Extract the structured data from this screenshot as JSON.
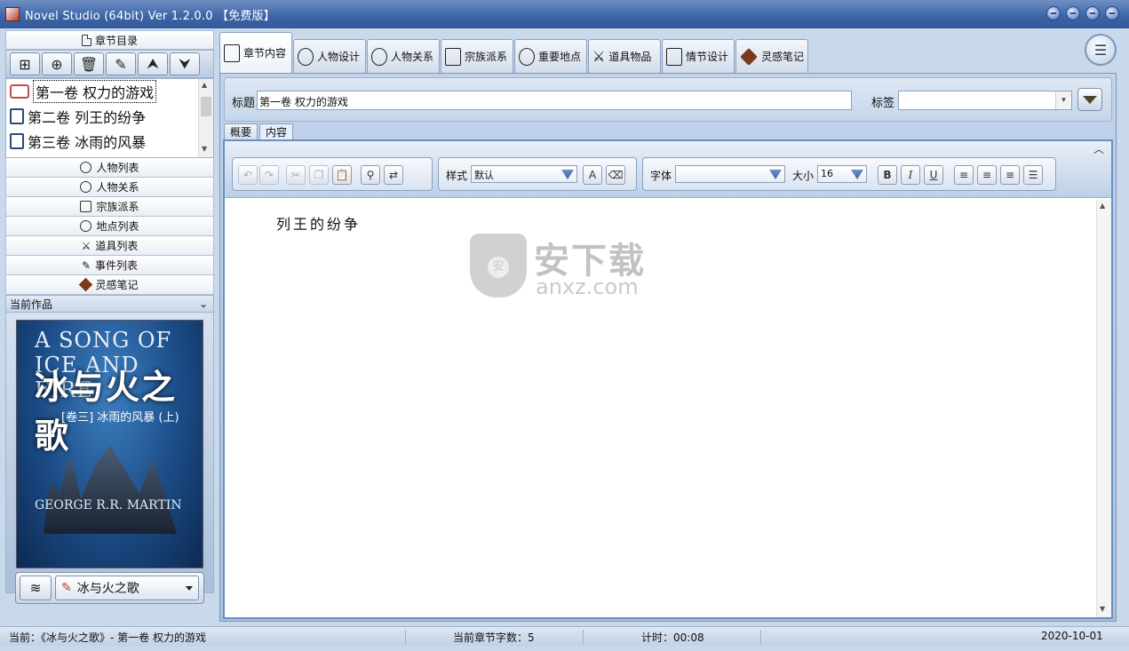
{
  "window": {
    "title": "Novel Studio  (64bit)  Ver 1.2.0.0  【免费版】"
  },
  "left": {
    "chapter_header": "章节目录",
    "chapters": [
      {
        "label": "第一卷  权力的游戏"
      },
      {
        "label": "第二卷  列王的纷争"
      },
      {
        "label": "第三卷  冰雨的风暴"
      }
    ],
    "lists": [
      {
        "label": "人物列表",
        "icon": "person-icon"
      },
      {
        "label": "人物关系",
        "icon": "relation-icon"
      },
      {
        "label": "宗族派系",
        "icon": "hierarchy-icon"
      },
      {
        "label": "地点列表",
        "icon": "location-icon"
      },
      {
        "label": "道具列表",
        "icon": "swords-icon"
      },
      {
        "label": "事件列表",
        "icon": "edit-icon"
      },
      {
        "label": "灵感笔记",
        "icon": "diamond-icon"
      }
    ],
    "current_work_label": "当前作品",
    "cover": {
      "line1": "A SONG OF ICE AND FIRE",
      "line2": "冰与火之歌",
      "line3": "[卷三] 冰雨的风暴 (上)",
      "author": "GEORGE R.R. MARTIN"
    },
    "work_select": "冰与火之歌"
  },
  "tabs": [
    {
      "label": "章节内容"
    },
    {
      "label": "人物设计"
    },
    {
      "label": "人物关系"
    },
    {
      "label": "宗族派系"
    },
    {
      "label": "重要地点"
    },
    {
      "label": "道具物品"
    },
    {
      "label": "情节设计"
    },
    {
      "label": "灵感笔记"
    }
  ],
  "editor": {
    "title_label": "标题",
    "title_value": "第一卷 权力的游戏",
    "tag_label": "标签",
    "subtabs": [
      "概要",
      "内容"
    ],
    "style_label": "样式",
    "style_value": "默认",
    "font_label": "字体",
    "font_value": "",
    "size_label": "大小",
    "size_value": "16",
    "content": "列王的纷争",
    "watermark_cn": "安下载",
    "watermark_en": "anxz.com"
  },
  "status": {
    "current": "当前：《冰与火之歌》- 第一卷 权力的游戏",
    "word_count": "当前章节字数：5",
    "timer": "计时：00:08",
    "date": "2020-10-01"
  }
}
